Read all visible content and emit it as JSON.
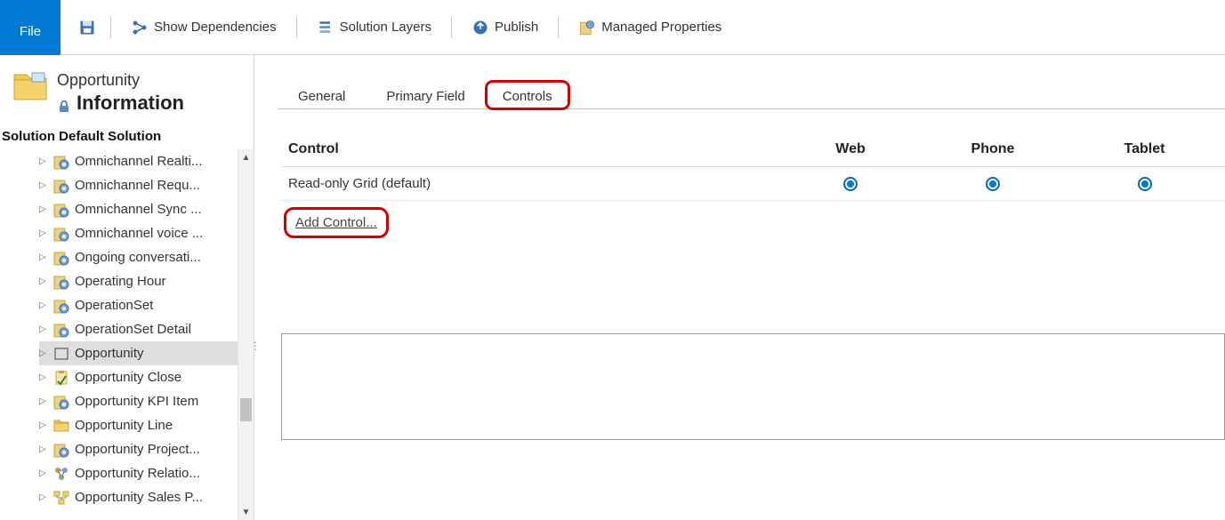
{
  "ribbon": {
    "file": "File",
    "items": [
      {
        "label": "Show Dependencies"
      },
      {
        "label": "Solution Layers"
      },
      {
        "label": "Publish"
      },
      {
        "label": "Managed Properties"
      }
    ]
  },
  "entity": {
    "name": "Opportunity",
    "page_title": "Information"
  },
  "solution_label": "Solution Default Solution",
  "tree": [
    {
      "label": "Omnichannel Realti...",
      "type": "gear"
    },
    {
      "label": "Omnichannel Requ...",
      "type": "gear"
    },
    {
      "label": "Omnichannel Sync ...",
      "type": "gear"
    },
    {
      "label": "Omnichannel voice ...",
      "type": "gear"
    },
    {
      "label": "Ongoing conversati...",
      "type": "gear"
    },
    {
      "label": "Operating Hour",
      "type": "gear"
    },
    {
      "label": "OperationSet",
      "type": "gear"
    },
    {
      "label": "OperationSet Detail",
      "type": "gear"
    },
    {
      "label": "Opportunity",
      "type": "entity",
      "selected": true
    },
    {
      "label": "Opportunity Close",
      "type": "clipboard"
    },
    {
      "label": "Opportunity KPI Item",
      "type": "gear"
    },
    {
      "label": "Opportunity Line",
      "type": "folder"
    },
    {
      "label": "Opportunity Project...",
      "type": "gear"
    },
    {
      "label": "Opportunity Relatio...",
      "type": "relationship"
    },
    {
      "label": "Opportunity Sales P...",
      "type": "process"
    }
  ],
  "tabs": [
    {
      "label": "General",
      "active": false,
      "highlight": false
    },
    {
      "label": "Primary Field",
      "active": false,
      "highlight": false
    },
    {
      "label": "Controls",
      "active": true,
      "highlight": true
    }
  ],
  "controls_table": {
    "headers": {
      "control": "Control",
      "web": "Web",
      "phone": "Phone",
      "tablet": "Tablet"
    },
    "rows": [
      {
        "name": "Read-only Grid (default)",
        "web": true,
        "phone": true,
        "tablet": true
      }
    ]
  },
  "add_control_label": "Add Control..."
}
